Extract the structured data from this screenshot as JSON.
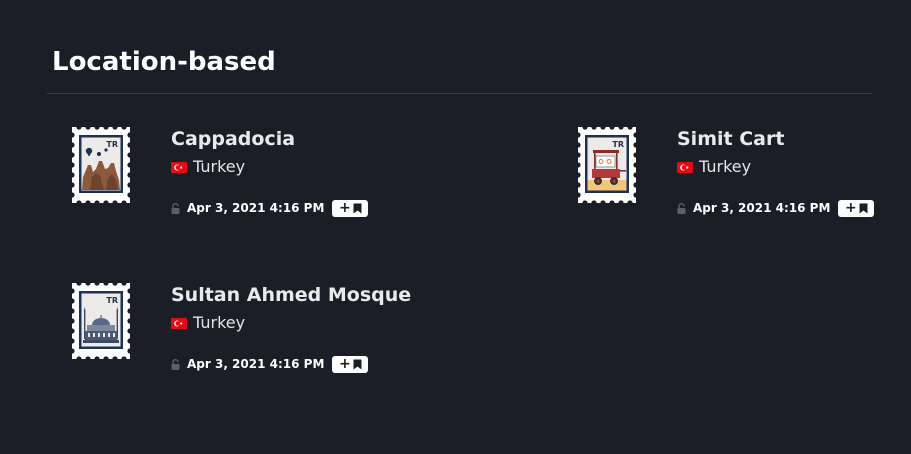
{
  "section": {
    "title": "Location-based"
  },
  "items": [
    {
      "name": "Cappadocia",
      "country": "Turkey",
      "country_code": "TR",
      "date": "Apr 3, 2021 4:16 PM",
      "add_label": "+",
      "stamp_icon": "cappadocia-stamp-icon"
    },
    {
      "name": "Simit Cart",
      "country": "Turkey",
      "country_code": "TR",
      "date": "Apr 3, 2021 4:16 PM",
      "add_label": "+",
      "stamp_icon": "simit-cart-stamp-icon"
    },
    {
      "name": "Sultan Ahmed Mosque",
      "country": "Turkey",
      "country_code": "TR",
      "date": "Apr 3, 2021 4:16 PM",
      "add_label": "+",
      "stamp_icon": "mosque-stamp-icon"
    }
  ],
  "colors": {
    "background": "#1b1e26",
    "divider": "#3a3d46",
    "stamp_frame": "#ffffff",
    "stamp_inner": "#1e3352",
    "flag_red": "#e30a17"
  }
}
